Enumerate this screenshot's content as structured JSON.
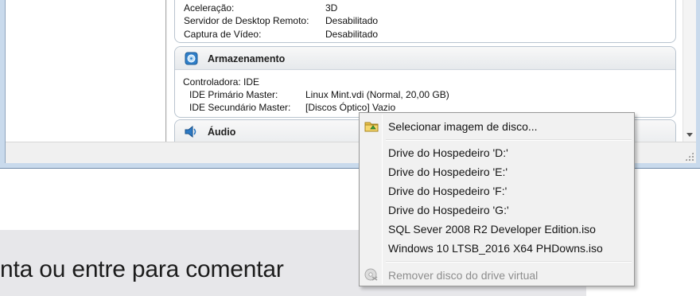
{
  "page": {
    "comment_prompt": "nta ou entre para comentar"
  },
  "details": {
    "top_rows": [
      {
        "label": "Aceleração:",
        "value": "3D"
      },
      {
        "label": "Servidor de Desktop Remoto:",
        "value": "Desabilitado"
      },
      {
        "label": "Captura de Vídeo:",
        "value": "Desabilitado"
      }
    ],
    "storage": {
      "title": "Armazenamento",
      "icon": "storage-icon",
      "controller": "Controladora: IDE",
      "primary_label": "IDE Primário Master:",
      "primary_value": "Linux Mint.vdi (Normal, 20,00 GB)",
      "secondary_label": "IDE Secundário Master:",
      "secondary_value": "[Discos Óptico] Vazio"
    },
    "audio": {
      "title": "Áudio",
      "icon": "speaker-icon"
    }
  },
  "context_menu": {
    "select_image": {
      "label": "Selecionar imagem de disco...",
      "icon": "folder-disk-icon"
    },
    "hosts": [
      "Drive do Hospedeiro 'D:'",
      "Drive do Hospedeiro 'E:'",
      "Drive do Hospedeiro 'F:'",
      "Drive do Hospedeiro 'G:'"
    ],
    "recent_isos": [
      "SQL Sever 2008 R2 Developer Edition.iso",
      "Windows 10 LTSB_2016 X64 PHDowns.iso"
    ],
    "remove": {
      "label": "Remover disco do drive virtual",
      "icon": "eject-disk-icon",
      "enabled": false
    }
  },
  "colors": {
    "window_frame": "#c9daec",
    "panel_border": "#b9c4cf",
    "menu_background": "#f1f1f1",
    "disabled_text": "#8d8d8d"
  }
}
